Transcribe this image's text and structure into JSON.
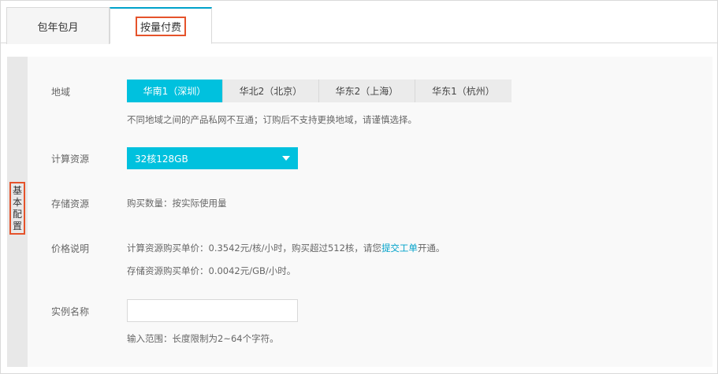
{
  "tabs": {
    "yearly_label": "包年包月",
    "payg_label": "按量付费"
  },
  "side": {
    "chars": [
      "基",
      "本",
      "配",
      "置"
    ]
  },
  "region": {
    "label": "地域",
    "options": [
      "华南1（深圳）",
      "华北2（北京）",
      "华东2（上海）",
      "华东1（杭州）"
    ],
    "selected_index": 0,
    "note": "不同地域之间的产品私网不互通；订购后不支持更换地域，请谨慎选择。"
  },
  "compute": {
    "label": "计算资源",
    "selected": "32核128GB"
  },
  "storage": {
    "label": "存储资源",
    "value": "购买数量：按实际使用量"
  },
  "price": {
    "label": "价格说明",
    "line1_prefix": "计算资源购买单价：0.3542元/核/小时，购买超过512核，请您",
    "line1_link": "提交工单",
    "line1_suffix": "开通。",
    "line2": "存储资源购买单价：0.0042元/GB/小时。"
  },
  "instance_name": {
    "label": "实例名称",
    "value": "",
    "placeholder": "",
    "hint": "输入范围：长度限制为2~64个字符。"
  },
  "colors": {
    "accent": "#00c1de",
    "tab_border": "#00a2ca",
    "highlight": "#e5532b"
  }
}
